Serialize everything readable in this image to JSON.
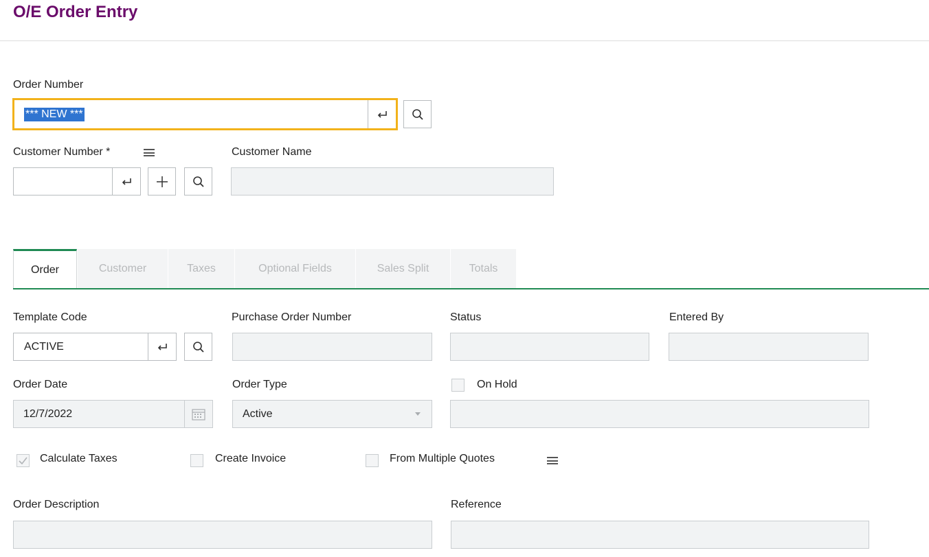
{
  "header": {
    "title": "O/E Order Entry"
  },
  "order_number": {
    "label": "Order Number",
    "value": "*** NEW ***"
  },
  "customer": {
    "number_label": "Customer Number *",
    "number_value": "",
    "name_label": "Customer Name",
    "name_value": ""
  },
  "tabs": [
    {
      "label": "Order",
      "active": true
    },
    {
      "label": "Customer",
      "active": false
    },
    {
      "label": "Taxes",
      "active": false
    },
    {
      "label": "Optional Fields",
      "active": false
    },
    {
      "label": "Sales Split",
      "active": false
    },
    {
      "label": "Totals",
      "active": false
    }
  ],
  "form": {
    "template_code": {
      "label": "Template Code",
      "value": "ACTIVE"
    },
    "purchase_order_number": {
      "label": "Purchase Order Number",
      "value": ""
    },
    "status": {
      "label": "Status",
      "value": ""
    },
    "entered_by": {
      "label": "Entered By",
      "value": ""
    },
    "order_date": {
      "label": "Order Date",
      "value": "12/7/2022"
    },
    "order_type": {
      "label": "Order Type",
      "value": "Active"
    },
    "on_hold": {
      "label": "On Hold",
      "checked": false,
      "reason": ""
    },
    "calculate_taxes": {
      "label": "Calculate Taxes",
      "checked": true
    },
    "create_invoice": {
      "label": "Create Invoice",
      "checked": false
    },
    "from_multiple_quotes": {
      "label": "From Multiple Quotes",
      "checked": false
    },
    "order_description": {
      "label": "Order Description",
      "value": ""
    },
    "reference": {
      "label": "Reference",
      "value": ""
    }
  },
  "colors": {
    "title": "#6b0d6b",
    "tab_active": "#1f8a53",
    "focus": "#f2b21b",
    "selection": "#2f74d0"
  },
  "icons": [
    "enter-icon",
    "search-icon",
    "plus-icon",
    "menu-icon",
    "calendar-icon",
    "chevron-down-icon",
    "checkmark-icon"
  ]
}
